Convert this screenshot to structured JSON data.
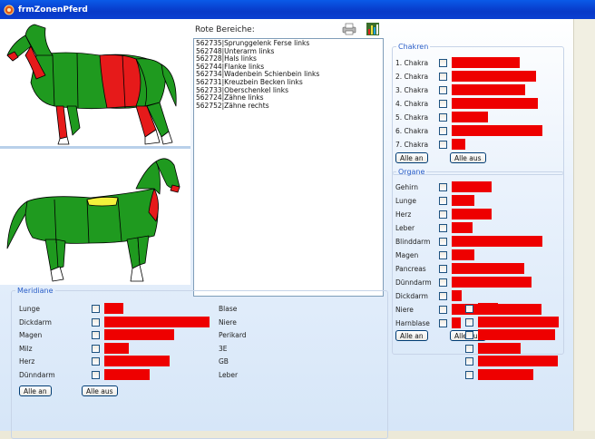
{
  "window": {
    "title": "frmZonenPferd"
  },
  "rote": {
    "label": "Rote Bereiche:",
    "items": [
      "562735|Sprunggelenk Ferse links",
      "562748|Unterarm links",
      "562728|Hals links",
      "562744|Flanke links",
      "562734|Wadenbein Schienbein links",
      "562731|Kreuzbein Becken links",
      "562733|Oberschenkel links",
      "562724|Zähne links",
      "562752|Zähne rechts"
    ]
  },
  "chakren": {
    "title": "Chakren",
    "items": [
      {
        "label": "1. Chakra",
        "level": 0.6
      },
      {
        "label": "2. Chakra",
        "level": 0.74
      },
      {
        "label": "3. Chakra",
        "level": 0.65
      },
      {
        "label": "4. Chakra",
        "level": 0.76
      },
      {
        "label": "5. Chakra",
        "level": 0.32
      },
      {
        "label": "6. Chakra",
        "level": 0.8
      },
      {
        "label": "7. Chakra",
        "level": 0.12
      }
    ],
    "btn_on": "Alle an",
    "btn_off": "Alle aus"
  },
  "organe": {
    "title": "Organe",
    "items": [
      {
        "label": "Gehirn",
        "level": 0.35
      },
      {
        "label": "Lunge",
        "level": 0.2
      },
      {
        "label": "Herz",
        "level": 0.35
      },
      {
        "label": "Leber",
        "level": 0.18
      },
      {
        "label": "Blinddarm",
        "level": 0.8
      },
      {
        "label": "Magen",
        "level": 0.2
      },
      {
        "label": "Pancreas",
        "level": 0.64
      },
      {
        "label": "Dünndarm",
        "level": 0.7
      },
      {
        "label": "Dickdarm",
        "level": 0.09
      },
      {
        "label": "Niere",
        "level": 0.79
      },
      {
        "label": "Harnblase",
        "level": 0.08
      }
    ],
    "btn_on": "Alle an",
    "btn_off": "Alle aus"
  },
  "meridiane": {
    "title": "Meridiane",
    "left": [
      {
        "label": "Lunge",
        "level": 0.18
      },
      {
        "label": "Dickdarm",
        "level": 1.0
      },
      {
        "label": "Magen",
        "level": 0.66
      },
      {
        "label": "Milz",
        "level": 0.23
      },
      {
        "label": "Herz",
        "level": 0.62
      },
      {
        "label": "Dünndarm",
        "level": 0.43
      }
    ],
    "right": [
      {
        "label": "Blase",
        "level": 0.23
      },
      {
        "label": "Niere",
        "level": 0.95
      },
      {
        "label": "Perikard",
        "level": 0.9
      },
      {
        "label": "3E",
        "level": 0.5
      },
      {
        "label": "GB",
        "level": 0.94
      },
      {
        "label": "Leber",
        "level": 0.65
      }
    ],
    "btn_on": "Alle an",
    "btn_off": "Alle aus"
  },
  "colors": {
    "bar": "#ee0000",
    "horse_green": "#1f9a1f",
    "horse_red": "#e61a1a",
    "horse_yellow": "#f2f23c",
    "group_title": "#2a5ec8"
  },
  "icons": [
    "app-icon",
    "print-icon",
    "chart-icon"
  ]
}
